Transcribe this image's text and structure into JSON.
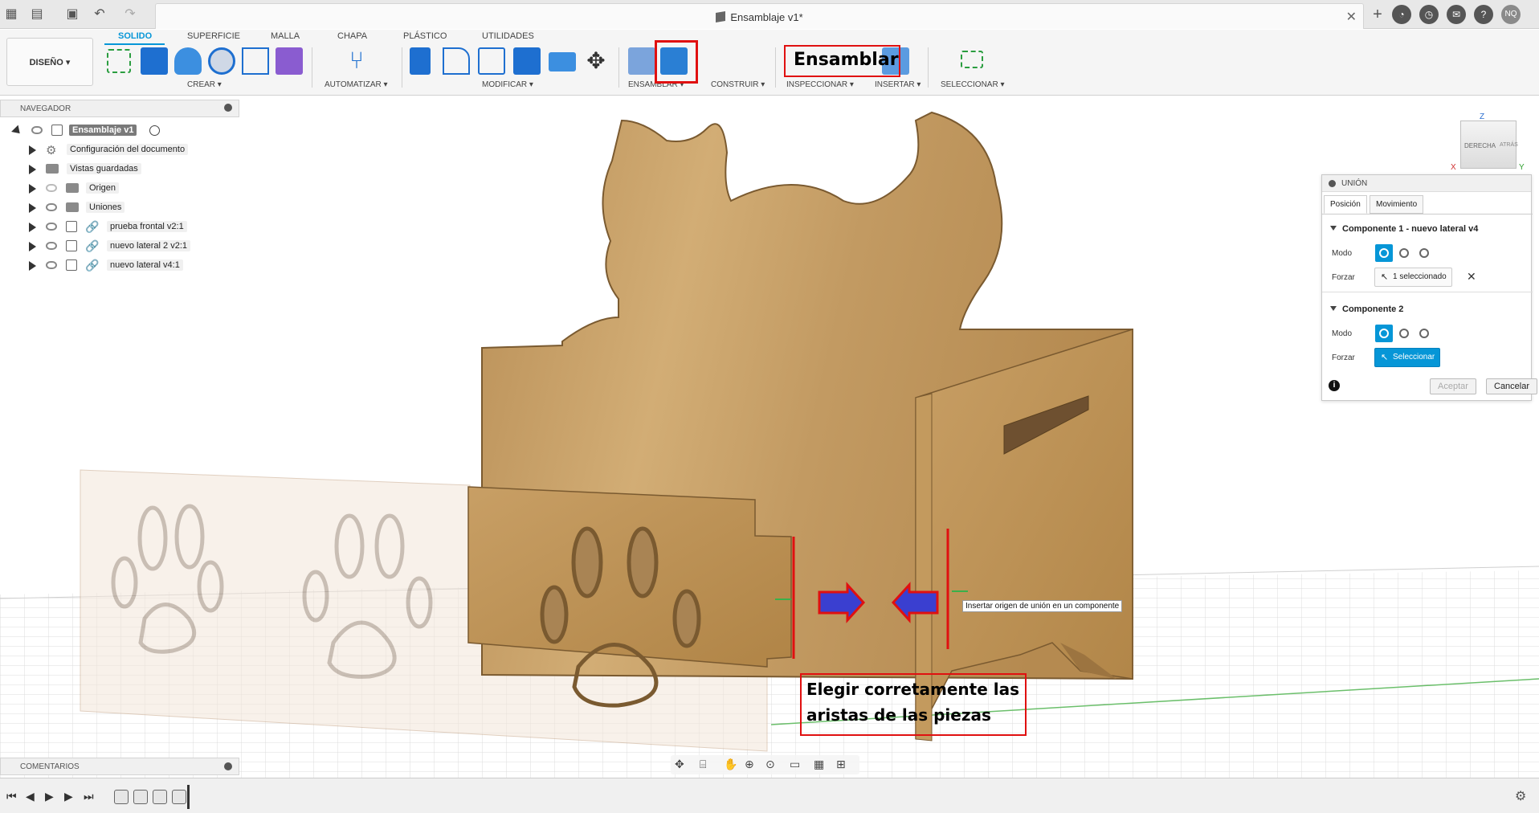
{
  "window": {
    "title": "Ensamblaje v1*",
    "user_initials": "NQ"
  },
  "ribbon": {
    "workspace_button": "DISEÑO ▾",
    "tabs": [
      "SOLIDO",
      "SUPERFICIE",
      "MALLA",
      "CHAPA",
      "PLÁSTICO",
      "UTILIDADES"
    ],
    "active_tab": "SOLIDO",
    "groups": [
      "CREAR ▾",
      "AUTOMATIZAR ▾",
      "MODIFICAR ▾",
      "ENSAMBLAR ▾",
      "CONSTRUIR ▾",
      "INSPECCIONAR ▾",
      "INSERTAR ▾",
      "SELECCIONAR ▾"
    ]
  },
  "navigator": {
    "title": "NAVEGADOR",
    "root": "Ensamblaje v1",
    "items": [
      {
        "label": "Configuración del documento",
        "icon": "gear-icon"
      },
      {
        "label": "Vistas guardadas",
        "icon": "folder-icon"
      },
      {
        "label": "Origen",
        "icon": "folder-icon"
      },
      {
        "label": "Uniones",
        "icon": "folder-icon"
      },
      {
        "label": "prueba frontal v2:1",
        "icon": "component-icon"
      },
      {
        "label": "nuevo lateral 2 v2:1",
        "icon": "component-icon"
      },
      {
        "label": "nuevo lateral v4:1",
        "icon": "component-icon"
      }
    ]
  },
  "union_panel": {
    "title": "UNIÓN",
    "tabs": [
      "Posición",
      "Movimiento"
    ],
    "component1": {
      "title": "Componente 1 - nuevo lateral v4",
      "mode_label": "Modo",
      "force_label": "Forzar",
      "force_value": "1 seleccionado"
    },
    "component2": {
      "title": "Componente 2",
      "mode_label": "Modo",
      "force_label": "Forzar",
      "force_value": "Seleccionar"
    },
    "accept": "Aceptar",
    "cancel": "Cancelar"
  },
  "viewcube": {
    "face": "DERECHA",
    "side_face": "ATRÁS",
    "axis_z": "Z",
    "axis_x": "X",
    "axis_y": "Y"
  },
  "annotations": {
    "ensamblar": "Ensamblar",
    "edges_line1": "Elegir corretamente las",
    "edges_line2": "aristas de las piezas"
  },
  "tooltip": "Insertar origen de unión en un componente",
  "comments": {
    "title": "COMENTARIOS"
  },
  "colors": {
    "accent": "#0696d7",
    "annotation_red": "#e01010",
    "annotation_blue": "#3a3fd0",
    "wood": "#c9a36b"
  }
}
